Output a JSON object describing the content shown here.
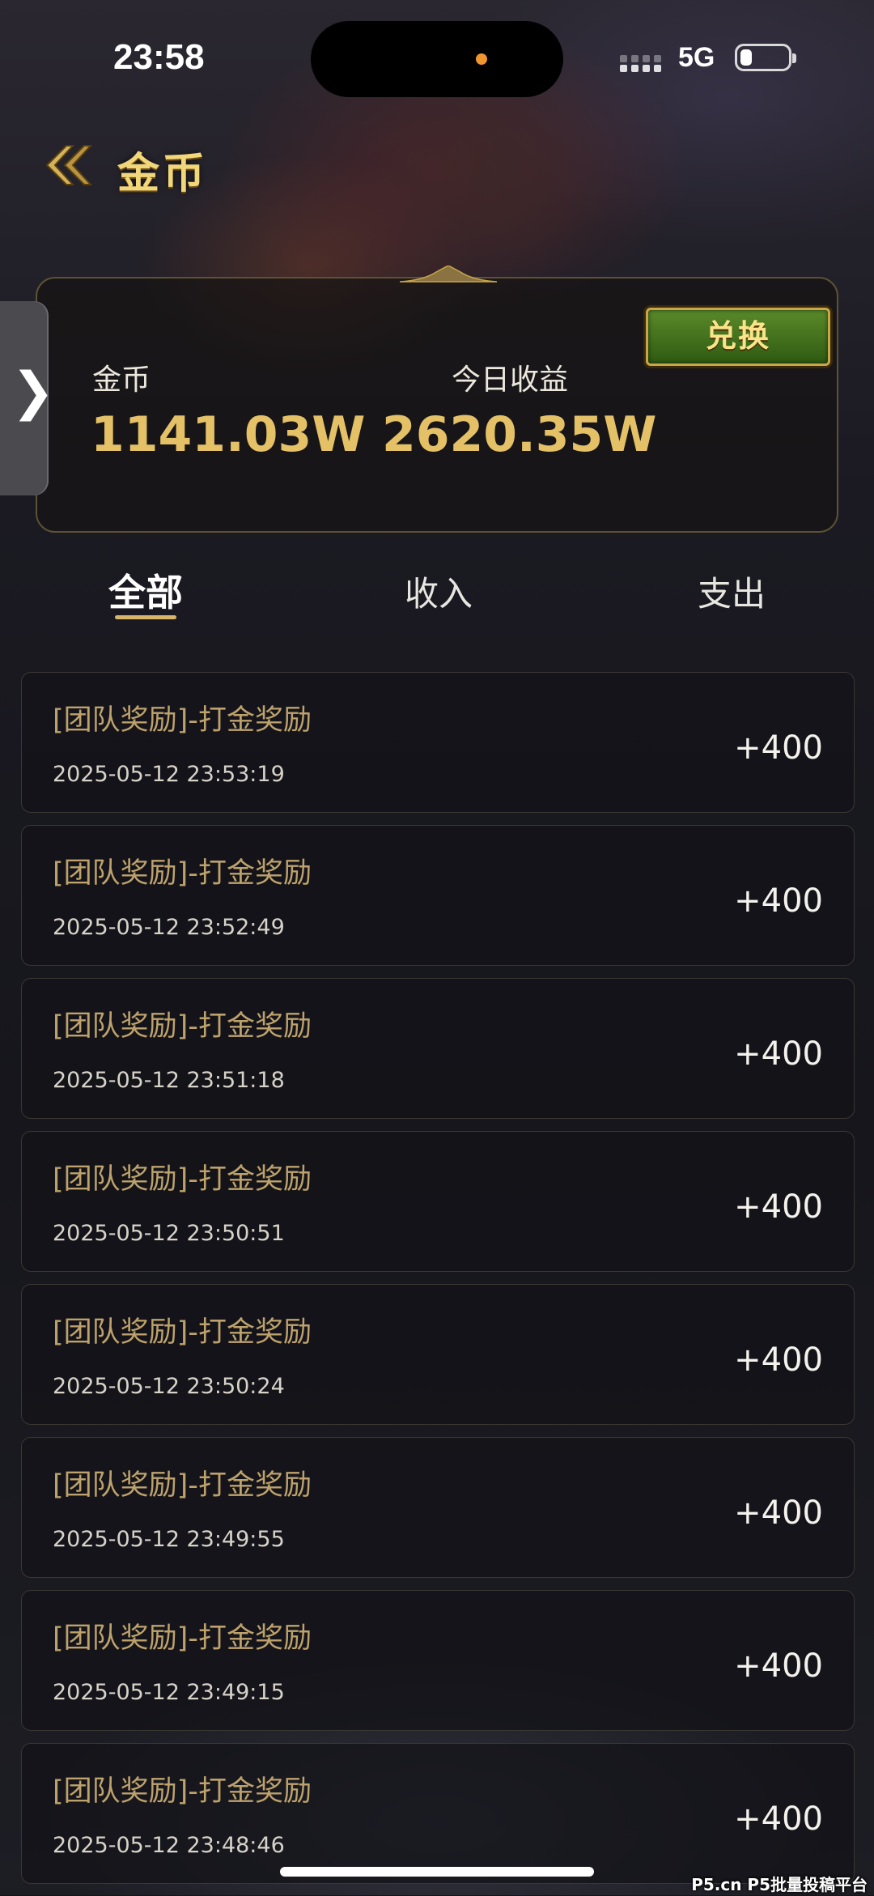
{
  "status_bar": {
    "time": "23:58",
    "network": "5G"
  },
  "header": {
    "back_icon": "double-chevron-left-icon",
    "title": "金币"
  },
  "side_tab": {
    "icon": "chevron-right-icon",
    "glyph": "❯"
  },
  "summary": {
    "exchange_label": "兑换",
    "coins_label": "金币",
    "coins_value": "1141.03W",
    "today_label": "今日收益",
    "today_value": "2620.35W"
  },
  "tabs": [
    {
      "label": "全部",
      "active": true
    },
    {
      "label": "收入",
      "active": false
    },
    {
      "label": "支出",
      "active": false
    }
  ],
  "transactions": [
    {
      "title": "[团队奖励]-打金奖励",
      "time": "2025-05-12 23:53:19",
      "amount": "+400"
    },
    {
      "title": "[团队奖励]-打金奖励",
      "time": "2025-05-12 23:52:49",
      "amount": "+400"
    },
    {
      "title": "[团队奖励]-打金奖励",
      "time": "2025-05-12 23:51:18",
      "amount": "+400"
    },
    {
      "title": "[团队奖励]-打金奖励",
      "time": "2025-05-12 23:50:51",
      "amount": "+400"
    },
    {
      "title": "[团队奖励]-打金奖励",
      "time": "2025-05-12 23:50:24",
      "amount": "+400"
    },
    {
      "title": "[团队奖励]-打金奖励",
      "time": "2025-05-12 23:49:55",
      "amount": "+400"
    },
    {
      "title": "[团队奖励]-打金奖励",
      "time": "2025-05-12 23:49:15",
      "amount": "+400"
    },
    {
      "title": "[团队奖励]-打金奖励",
      "time": "2025-05-12 23:48:46",
      "amount": "+400"
    }
  ],
  "watermark": "P5.cn P5批量投稿平台",
  "colors": {
    "gold_text": "#e4c167",
    "item_title": "#bda26c",
    "button_green": "#3f6f1c",
    "background": "#15151b"
  }
}
